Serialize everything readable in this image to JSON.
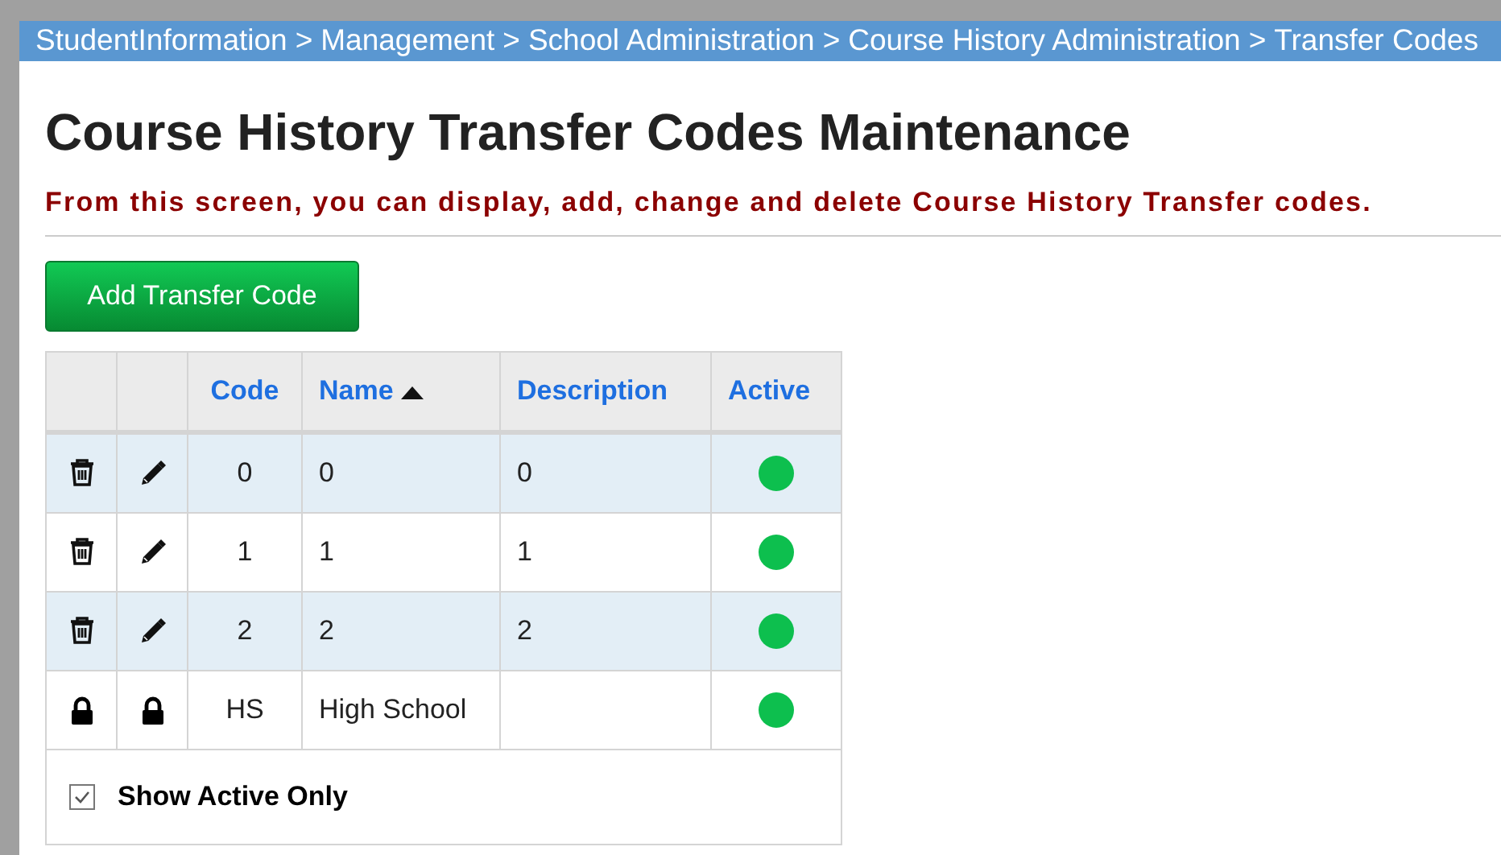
{
  "breadcrumb": [
    "StudentInformation",
    "Management",
    "School Administration",
    "Course History Administration",
    "Transfer Codes"
  ],
  "breadcrumb_separator": ">",
  "title": "Course History Transfer Codes Maintenance",
  "instructions": "From this screen, you can display, add, change and delete Course History Transfer codes.",
  "add_button": "Add Transfer Code",
  "table": {
    "columns": [
      {
        "label": "Code",
        "sorted_ascending": false
      },
      {
        "label": "Name",
        "sorted_ascending": true
      },
      {
        "label": "Description",
        "sorted_ascending": false
      },
      {
        "label": "Active",
        "sorted_ascending": false
      }
    ],
    "rows": [
      {
        "kind": "editable",
        "code": "0",
        "name": "0",
        "description": "0",
        "active": true
      },
      {
        "kind": "editable",
        "code": "1",
        "name": "1",
        "description": "1",
        "active": true
      },
      {
        "kind": "editable",
        "code": "2",
        "name": "2",
        "description": "2",
        "active": true
      },
      {
        "kind": "locked",
        "code": "HS",
        "name": "High School",
        "active": true
      }
    ]
  },
  "show_active_only": {
    "label": "Show Active Only",
    "checked": true
  }
}
